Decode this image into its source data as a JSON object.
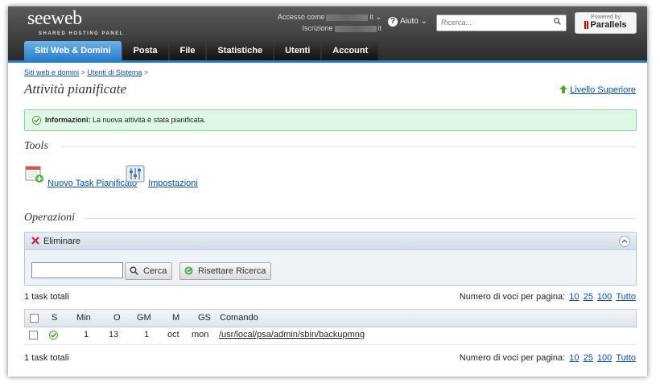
{
  "brand": {
    "name": "seeweb",
    "tagline": "SHARED HOSTING PANEL"
  },
  "login": {
    "access_label": "Accesso come",
    "access_suffix": "it",
    "signup_label": "Iscrizione",
    "signup_suffix": "it"
  },
  "help": {
    "label": "Aiuto"
  },
  "search": {
    "placeholder": "Ricerca..."
  },
  "parallels": {
    "powered": "Powered by",
    "name": "Parallels"
  },
  "tabs": [
    {
      "label": "Siti Web & Domini"
    },
    {
      "label": "Posta"
    },
    {
      "label": "File"
    },
    {
      "label": "Statistiche"
    },
    {
      "label": "Utenti"
    },
    {
      "label": "Account"
    }
  ],
  "breadcrumb": {
    "items": [
      "Siti web e domini",
      "Utenti di Sistema"
    ],
    "sep": ">"
  },
  "page": {
    "title": "Attività pianificate",
    "up_link": "Livello Superiore"
  },
  "message": {
    "label": "Informazioni:",
    "text": "La nuova attività è stata pianificata."
  },
  "tools": {
    "heading": "Tools",
    "items": [
      {
        "label": "Nuovo Task Pianificato"
      },
      {
        "label": "Impostazioni"
      }
    ]
  },
  "operations": {
    "heading": "Operazioni",
    "delete_label": "Eliminare",
    "search_value": "",
    "search_button": "Cerca",
    "reset_button": "Risettare Ricerca"
  },
  "list": {
    "total_text": "1 task totali",
    "per_page_label": "Numero di voci per pagina:",
    "per_page_options": [
      "10",
      "25",
      "100",
      "Tutto"
    ],
    "columns": [
      "S",
      "Min",
      "O",
      "GM",
      "M",
      "GS",
      "Comando"
    ],
    "rows": [
      {
        "min": "1",
        "o": "13",
        "gm": "1",
        "m": "oct",
        "gs": "mon",
        "command": "/usr/local/psa/admin/sbin/backupmng"
      }
    ]
  },
  "colors": {
    "tab_active": "#2a7dca",
    "success_bg": "#dff7e6",
    "link": "#0b4f9a",
    "topbar": "#3a3a3a"
  }
}
